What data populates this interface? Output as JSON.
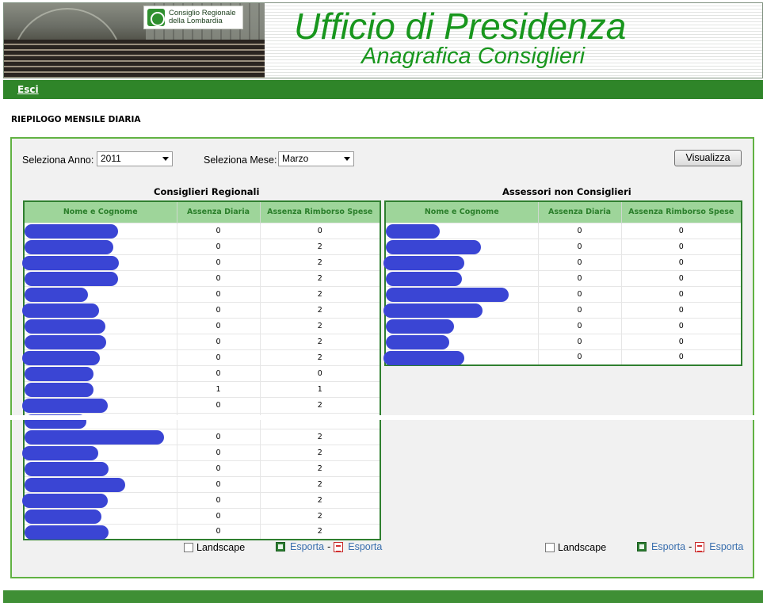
{
  "header": {
    "logo_line1": "Consiglio Regionale",
    "logo_line2": "della Lombardia",
    "title": "Ufficio di Presidenza",
    "subtitle": "Anagrafica Consiglieri"
  },
  "nav": {
    "exit_label": "Esci"
  },
  "page_title": "RIEPILOGO MENSILE DIARIA",
  "filters": {
    "year_label": "Seleziona Anno:",
    "year_value": "2011",
    "month_label": "Seleziona Mese:",
    "month_value": "Marzo",
    "submit_label": "Visualizza"
  },
  "consiglieri": {
    "title": "Consiglieri Regionali",
    "columns": [
      "Nome e Cognome",
      "Assenza Diaria",
      "Assenza Rimborso Spese"
    ],
    "rows": [
      {
        "diaria": "0",
        "rimborso": "0"
      },
      {
        "diaria": "0",
        "rimborso": "2"
      },
      {
        "diaria": "0",
        "rimborso": "2"
      },
      {
        "diaria": "0",
        "rimborso": "2"
      },
      {
        "diaria": "0",
        "rimborso": "2"
      },
      {
        "diaria": "0",
        "rimborso": "2"
      },
      {
        "diaria": "0",
        "rimborso": "2"
      },
      {
        "diaria": "0",
        "rimborso": "2"
      },
      {
        "diaria": "0",
        "rimborso": "2"
      },
      {
        "diaria": "0",
        "rimborso": "0"
      },
      {
        "diaria": "1",
        "rimborso": "1"
      },
      {
        "diaria": "0",
        "rimborso": "2"
      },
      {
        "diaria": "",
        "rimborso": ""
      },
      {
        "diaria": "0",
        "rimborso": "2"
      },
      {
        "diaria": "0",
        "rimborso": "2"
      },
      {
        "diaria": "0",
        "rimborso": "2"
      },
      {
        "diaria": "0",
        "rimborso": "2"
      },
      {
        "diaria": "0",
        "rimborso": "2"
      },
      {
        "diaria": "0",
        "rimborso": "2"
      },
      {
        "diaria": "0",
        "rimborso": "2"
      }
    ],
    "landscape_label": "Landscape",
    "export_xls_label": "Esporta",
    "export_pdf_label": "Esporta",
    "export_separator": "-"
  },
  "assessori": {
    "title": "Assessori non Consiglieri",
    "columns": [
      "Nome e Cognome",
      "Assenza Diaria",
      "Assenza Rimborso Spese"
    ],
    "rows": [
      {
        "diaria": "0",
        "rimborso": "0"
      },
      {
        "diaria": "0",
        "rimborso": "0"
      },
      {
        "diaria": "0",
        "rimborso": "0"
      },
      {
        "diaria": "0",
        "rimborso": "0"
      },
      {
        "diaria": "0",
        "rimborso": "0"
      },
      {
        "diaria": "0",
        "rimborso": "0"
      },
      {
        "diaria": "0",
        "rimborso": "0"
      },
      {
        "diaria": "0",
        "rimborso": "0"
      },
      {
        "diaria": "0",
        "rimborso": "0"
      }
    ],
    "landscape_label": "Landscape",
    "export_xls_label": "Esporta",
    "export_pdf_label": "Esporta",
    "export_separator": "-"
  },
  "colors": {
    "brand_green": "#18961d",
    "nav_green": "#2f8529",
    "header_cell_bg": "#9ed59a",
    "redaction_blue": "#3a45d4"
  }
}
